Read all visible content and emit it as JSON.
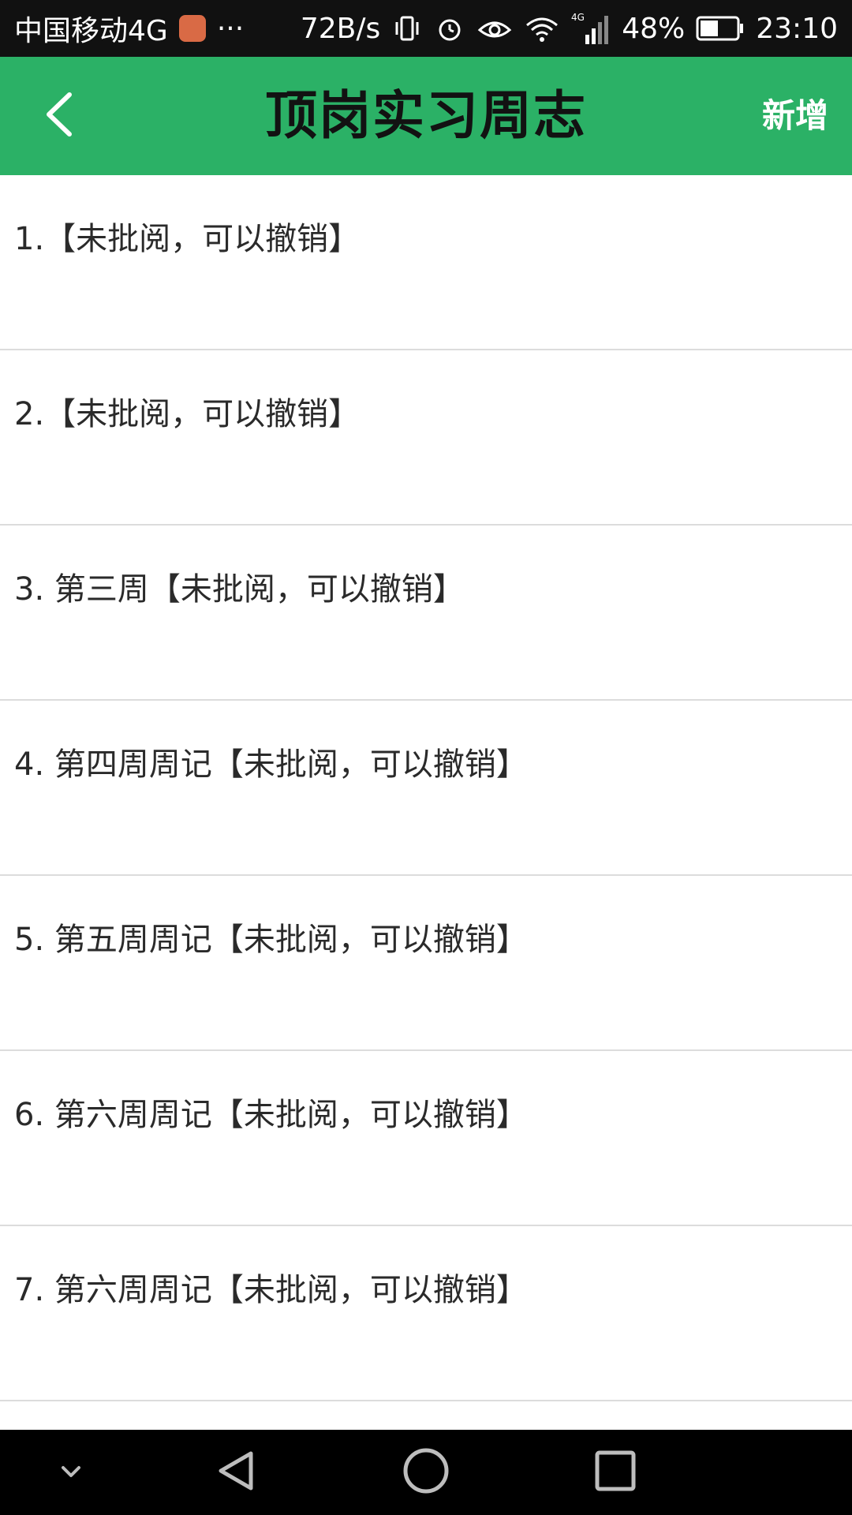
{
  "status_bar": {
    "carrier": "中国移动4G",
    "more": "···",
    "net_speed": "72B/s",
    "network_type": "4G",
    "battery": "48%",
    "time": "23:10",
    "icons": [
      "vibrate-icon",
      "alarm-icon",
      "eye-icon",
      "wifi-icon",
      "signal-icon",
      "battery-icon"
    ]
  },
  "app_bar": {
    "title": "顶岗实习周志",
    "add_label": "新增",
    "back_icon": "chevron-left-icon",
    "color": "#2bb166"
  },
  "list": {
    "items": [
      {
        "label": "1.【未批阅，可以撤销】"
      },
      {
        "label": "2.【未批阅，可以撤销】"
      },
      {
        "label": "3. 第三周【未批阅，可以撤销】"
      },
      {
        "label": "4. 第四周周记【未批阅，可以撤销】"
      },
      {
        "label": "5. 第五周周记【未批阅，可以撤销】"
      },
      {
        "label": "6. 第六周周记【未批阅，可以撤销】"
      },
      {
        "label": "7. 第六周周记【未批阅，可以撤销】"
      }
    ]
  },
  "nav_bar": {
    "icons": [
      "chevron-down-icon",
      "back-triangle-icon",
      "home-circle-icon",
      "recents-square-icon"
    ]
  }
}
